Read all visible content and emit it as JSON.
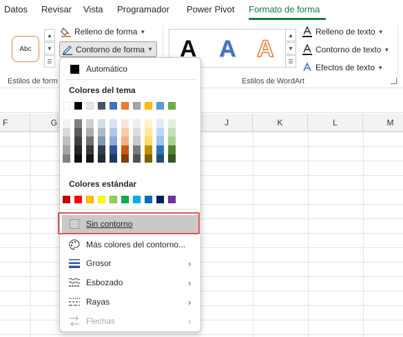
{
  "tabs": [
    {
      "label": "Datos"
    },
    {
      "label": "Revisar"
    },
    {
      "label": "Vista"
    },
    {
      "label": "Programador"
    },
    {
      "label": "Power Pivot"
    },
    {
      "label": "Formato de forma"
    }
  ],
  "ribbon": {
    "shape_styles": {
      "sample_text": "Abc",
      "fill_label": "Relleno de forma",
      "outline_label": "Contorno de forma",
      "group_label": "Estilos de form"
    },
    "wordart": {
      "letter": "A",
      "text_fill_label": "Relleno de texto",
      "text_outline_label": "Contorno de texto",
      "text_effects_label": "Efectos de texto",
      "group_label": "Estilos de WordArt"
    }
  },
  "grid": {
    "columns": [
      "F",
      "G",
      "J",
      "K",
      "L",
      "M"
    ]
  },
  "menu": {
    "automatic_label": "Automático",
    "theme_colors_title": "Colores del tema",
    "standard_colors_title": "Colores estándar",
    "no_outline_label": "Sin contorno",
    "more_colors_label": "Más colores del contorno...",
    "weight_label": "Grosor",
    "sketched_label": "Esbozado",
    "dashes_label": "Rayas",
    "arrows_label": "Flechas",
    "theme_top_row": [
      "#ffffff",
      "#000000",
      "#e7e6e6",
      "#44546a",
      "#4472c4",
      "#ed7d31",
      "#a5a5a5",
      "#ffc000",
      "#5b9bd5",
      "#70ad47"
    ],
    "theme_shades": [
      [
        "#f2f2f2",
        "#d9d9d9",
        "#bfbfbf",
        "#a6a6a6",
        "#808080"
      ],
      [
        "#808080",
        "#595959",
        "#404040",
        "#262626",
        "#0d0d0d"
      ],
      [
        "#d0cece",
        "#aeaaaa",
        "#757171",
        "#3a3838",
        "#171616"
      ],
      [
        "#d6dce4",
        "#adb9ca",
        "#8497b0",
        "#333f4f",
        "#222a35"
      ],
      [
        "#d9e2f3",
        "#b4c6e7",
        "#8eaadb",
        "#2f5496",
        "#1f3864"
      ],
      [
        "#fbe5d6",
        "#f8cbad",
        "#f4b183",
        "#c55a11",
        "#843c0c"
      ],
      [
        "#ededed",
        "#dbdbdb",
        "#c9c9c9",
        "#7b7b7b",
        "#525252"
      ],
      [
        "#fff2cc",
        "#ffe699",
        "#ffd966",
        "#bf9000",
        "#806000"
      ],
      [
        "#deebf7",
        "#bdd7ee",
        "#9dc3e6",
        "#2e75b6",
        "#1f4e79"
      ],
      [
        "#e2f0d9",
        "#c5e0b4",
        "#a9d18e",
        "#548235",
        "#385723"
      ]
    ],
    "standard_colors": [
      "#c00000",
      "#ff0000",
      "#ffc000",
      "#ffff00",
      "#92d050",
      "#00b050",
      "#00b0f0",
      "#0070c0",
      "#002060",
      "#7030a0"
    ]
  }
}
